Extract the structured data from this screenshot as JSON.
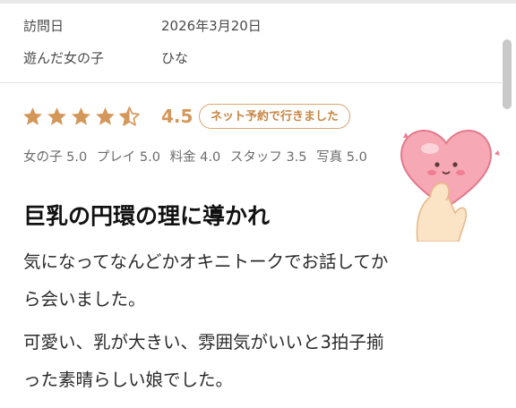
{
  "visit": {
    "date_label": "訪問日",
    "date_value": "2026年3月20日",
    "girl_label": "遊んだ女の子",
    "girl_value": "ひな"
  },
  "rating": {
    "value": "4.5",
    "stars": 4.5,
    "badge": "ネット予約で行きました",
    "star_color": "#d4975a"
  },
  "scores": [
    {
      "label": "女の子",
      "value": "5.0"
    },
    {
      "label": "プレイ",
      "value": "5.0"
    },
    {
      "label": "料金",
      "value": "4.0"
    },
    {
      "label": "スタッフ",
      "value": "3.5"
    },
    {
      "label": "写真",
      "value": "5.0"
    }
  ],
  "review": {
    "title": "巨乳の円環の理に導かれ",
    "lines": [
      "気になってなんどかオキニトークでお話してか",
      "ら会いました。",
      "可愛い、乳が大きい、雰囲気がいいと3拍子揃",
      "った素晴らしい娘でした。"
    ]
  },
  "illustration": {
    "icon": "hand-holding-heart-icon"
  }
}
